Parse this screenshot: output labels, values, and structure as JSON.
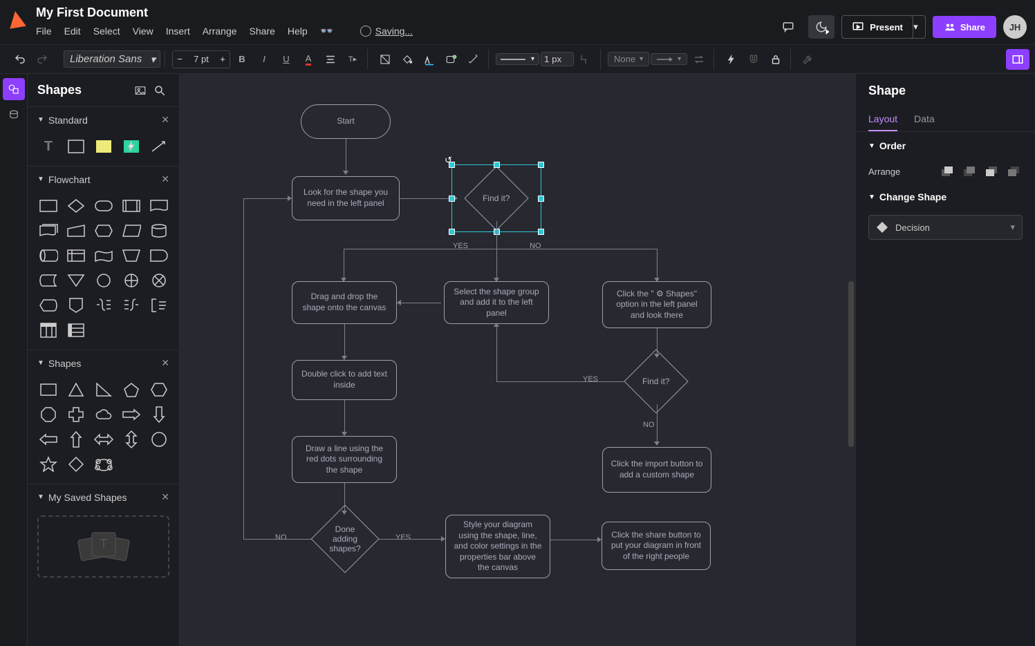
{
  "header": {
    "title": "My First Document",
    "menus": [
      "File",
      "Edit",
      "Select",
      "View",
      "Insert",
      "Arrange",
      "Share",
      "Help"
    ],
    "saving": "Saving...",
    "present": "Present",
    "share": "Share",
    "avatar": "JH"
  },
  "toolbar": {
    "font": "Liberation Sans",
    "size": "7 pt",
    "lineWidth": "1 px",
    "endpoint": "None"
  },
  "leftPanel": {
    "title": "Shapes",
    "sections": {
      "standard": "Standard",
      "flowchart": "Flowchart",
      "shapes": "Shapes",
      "saved": "My Saved Shapes"
    }
  },
  "rightPanel": {
    "title": "Shape",
    "tabLayout": "Layout",
    "tabData": "Data",
    "order": "Order",
    "arrange": "Arrange",
    "changeShape": "Change Shape",
    "shapeType": "Decision"
  },
  "nodes": {
    "start": "Start",
    "look": "Look for the shape you need in the left panel",
    "find1": "Find it?",
    "yes1": "YES",
    "no1": "NO",
    "drag": "Drag and drop the shape onto the canvas",
    "selectGroup": "Select the shape group and add it to the left panel",
    "clickShapes": "Click the \" ⚙ Shapes\" option in the left panel and look there",
    "dbl": "Double click to add text inside",
    "find2": "Find it?",
    "yes2": "YES",
    "no2": "NO",
    "drawLine": "Draw a line using the red dots surrounding the shape",
    "import": "Click the import button to add a custom shape",
    "done": "Done adding shapes?",
    "no3": "NO",
    "yes3": "YES",
    "style": "Style your diagram using the shape, line, and color settings in the properties bar above the canvas",
    "shareOut": "Click the share button to put your diagram in front of the right people"
  }
}
